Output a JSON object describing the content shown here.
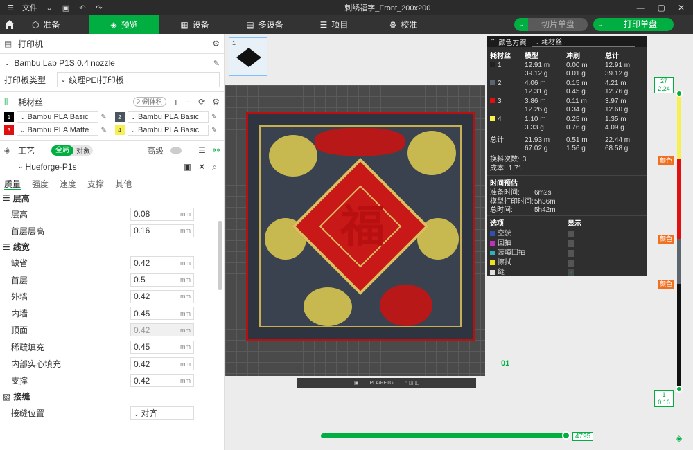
{
  "titlebar": {
    "file_label": "文件",
    "title": "刺绣福字_Front_200x200"
  },
  "nav": {
    "tabs": [
      {
        "label": "准备",
        "icon": "cube-icon"
      },
      {
        "label": "预览",
        "icon": "layers-icon",
        "active": true
      },
      {
        "label": "设备",
        "icon": "device-icon"
      },
      {
        "label": "多设备",
        "icon": "multi-device-icon"
      },
      {
        "label": "项目",
        "icon": "project-icon"
      },
      {
        "label": "校准",
        "icon": "calibrate-icon"
      }
    ],
    "slice_button": "切片单盘",
    "print_button": "打印单盘"
  },
  "left": {
    "printer_section": "打印机",
    "printer_name": "Bambu Lab P1S 0.4 nozzle",
    "plate_type_label": "打印板类型",
    "plate_type_value": "纹理PEI打印板",
    "filament_section": "耗材丝",
    "flush_badge": "冲刷体积",
    "filaments": [
      {
        "num": "1",
        "name": "Bambu PLA Basic",
        "color": "#000000",
        "text": "#ffffff"
      },
      {
        "num": "2",
        "name": "Bambu PLA Basic",
        "color": "#4a5560",
        "text": "#ffffff"
      },
      {
        "num": "3",
        "name": "Bambu PLA Matte",
        "color": "#e01010",
        "text": "#ffffff"
      },
      {
        "num": "4",
        "name": "Bambu PLA Basic",
        "color": "#f8f050",
        "text": "#333333"
      }
    ],
    "process_section": "工艺",
    "toggle_global": "全局",
    "toggle_object": "对象",
    "advanced_label": "高级",
    "process_preset": "Hueforge-P1s",
    "tabs": [
      "质量",
      "强度",
      "速度",
      "支撑",
      "其他"
    ],
    "groups": [
      {
        "name": "层高",
        "params": [
          {
            "label": "层高",
            "value": "0.08",
            "unit": "mm"
          },
          {
            "label": "首层层高",
            "value": "0.16",
            "unit": "mm"
          }
        ]
      },
      {
        "name": "线宽",
        "params": [
          {
            "label": "缺省",
            "value": "0.42",
            "unit": "mm"
          },
          {
            "label": "首层",
            "value": "0.5",
            "unit": "mm"
          },
          {
            "label": "外墙",
            "value": "0.42",
            "unit": "mm"
          },
          {
            "label": "内墙",
            "value": "0.45",
            "unit": "mm"
          },
          {
            "label": "顶面",
            "value": "0.42",
            "unit": "mm",
            "disabled": true
          },
          {
            "label": "稀疏填充",
            "value": "0.45",
            "unit": "mm"
          },
          {
            "label": "内部实心填充",
            "value": "0.42",
            "unit": "mm"
          },
          {
            "label": "支撑",
            "value": "0.42",
            "unit": "mm"
          }
        ]
      },
      {
        "name": "接缝",
        "params": [
          {
            "label": "接缝位置",
            "value": "对齐",
            "unit": ""
          }
        ]
      }
    ]
  },
  "viewport": {
    "plate_number": "1",
    "bed_label": "PLA/PETG",
    "axis_label": "01"
  },
  "color_panel": {
    "title": "颜色方案",
    "scheme": "耗材丝",
    "headers": [
      "耗材丝",
      "模型",
      "冲刷",
      "总计"
    ],
    "rows": [
      {
        "id": "1",
        "color": "#222222",
        "model": [
          "12.91 m",
          "39.12 g"
        ],
        "flush": [
          "0.00 m",
          "0.01 g"
        ],
        "total": [
          "12.91 m",
          "39.12 g"
        ]
      },
      {
        "id": "2",
        "color": "#5a6570",
        "model": [
          "4.06 m",
          "12.31 g"
        ],
        "flush": [
          "0.15 m",
          "0.45 g"
        ],
        "total": [
          "4.21 m",
          "12.76 g"
        ]
      },
      {
        "id": "3",
        "color": "#e01010",
        "model": [
          "3.86 m",
          "12.26 g"
        ],
        "flush": [
          "0.11 m",
          "0.34 g"
        ],
        "total": [
          "3.97 m",
          "12.60 g"
        ]
      },
      {
        "id": "4",
        "color": "#f8f050",
        "model": [
          "1.10 m",
          "3.33 g"
        ],
        "flush": [
          "0.25 m",
          "0.76 g"
        ],
        "total": [
          "1.35 m",
          "4.09 g"
        ]
      }
    ],
    "sum_label": "总计",
    "sum_model": [
      "21.93 m",
      "67.02 g"
    ],
    "sum_flush": [
      "0.51 m",
      "1.56 g"
    ],
    "sum_total": [
      "22.44 m",
      "68.58 g"
    ],
    "changes_label": "换料次数:",
    "changes_value": "3",
    "cost_label": "成本:",
    "cost_value": "1.71",
    "time_title": "时间预估",
    "prep_label": "准备时间:",
    "prep_value": "6m2s",
    "model_time_label": "模型打印时间:",
    "model_time_value": "5h36m",
    "total_time_label": "总时间:",
    "total_time_value": "5h42m",
    "options_label": "选项",
    "display_label": "显示",
    "options": [
      {
        "label": "空驶",
        "color": "#3050b0",
        "checked": false
      },
      {
        "label": "回抽",
        "color": "#c030c0",
        "checked": false
      },
      {
        "label": "装填回抽",
        "color": "#30b0c0",
        "checked": false
      },
      {
        "label": "擦拭",
        "color": "#f0e020",
        "checked": false
      },
      {
        "label": "缝",
        "color": "#e0e0e0",
        "checked": true
      }
    ]
  },
  "slider": {
    "top_layer": "27",
    "top_height": "2.24",
    "bottom_layer": "1",
    "bottom_height": "0.16",
    "color_tag": "颜色",
    "move_value": "4795"
  }
}
